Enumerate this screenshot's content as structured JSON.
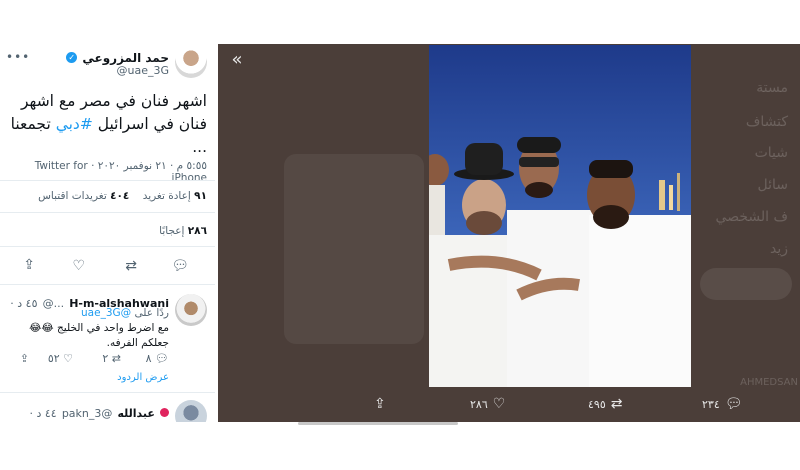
{
  "tweet": {
    "author_name": "حمد المزروعي",
    "author_handle": "@uae_3G",
    "more_label": "•••",
    "text_line1": "اشهر فنان في مصر مع اشهر",
    "text_line2_pre": "فنان في اسرائيل ",
    "hashtag": "#دبي",
    "text_line2_post": " تجمعنا",
    "text_line3": "...",
    "time": "٥:٥٥ م · ٢١ نوفمبر ٢٠٢٠ ·",
    "source": "Twitter for iPhone",
    "retweets_count": "٩١",
    "retweets_label": "إعادة تغريد",
    "quotes_count": "٤٠٤",
    "quotes_label": "تغريدات اقتباس",
    "likes_count": "٢٨٦",
    "likes_label": "إعجابًا"
  },
  "reply1": {
    "name": "H-m-alshahwani",
    "handle": "...@",
    "time": "٤٥ د ·",
    "replying_prefix": "ردًا على",
    "replying_handle": "@uae_3G",
    "text": "مع اضرط واحد في الخليج 😂😂 جعلكم الفرفه.",
    "reply_count": "٨",
    "retweet_count": "٢",
    "like_count": "٥٢",
    "show_replies": "عرض الردود"
  },
  "reply2": {
    "name": "عبدالله",
    "handle": "@3_pakn",
    "time": "٤٤ د ·"
  },
  "modal": {
    "close_label": "«",
    "reply_count": "٢٣٤",
    "retweet_count": "٤٩٥",
    "like_count": "٢٨٦",
    "ghost_items": [
      "مستة",
      "كتشاف",
      "شيات",
      "سائل",
      "ف الشخصي",
      "زيد"
    ],
    "ghost_handle": "AHMEDSAN"
  },
  "colors": {
    "accent": "#1d9bf0",
    "overlay": "#4b3e39"
  }
}
